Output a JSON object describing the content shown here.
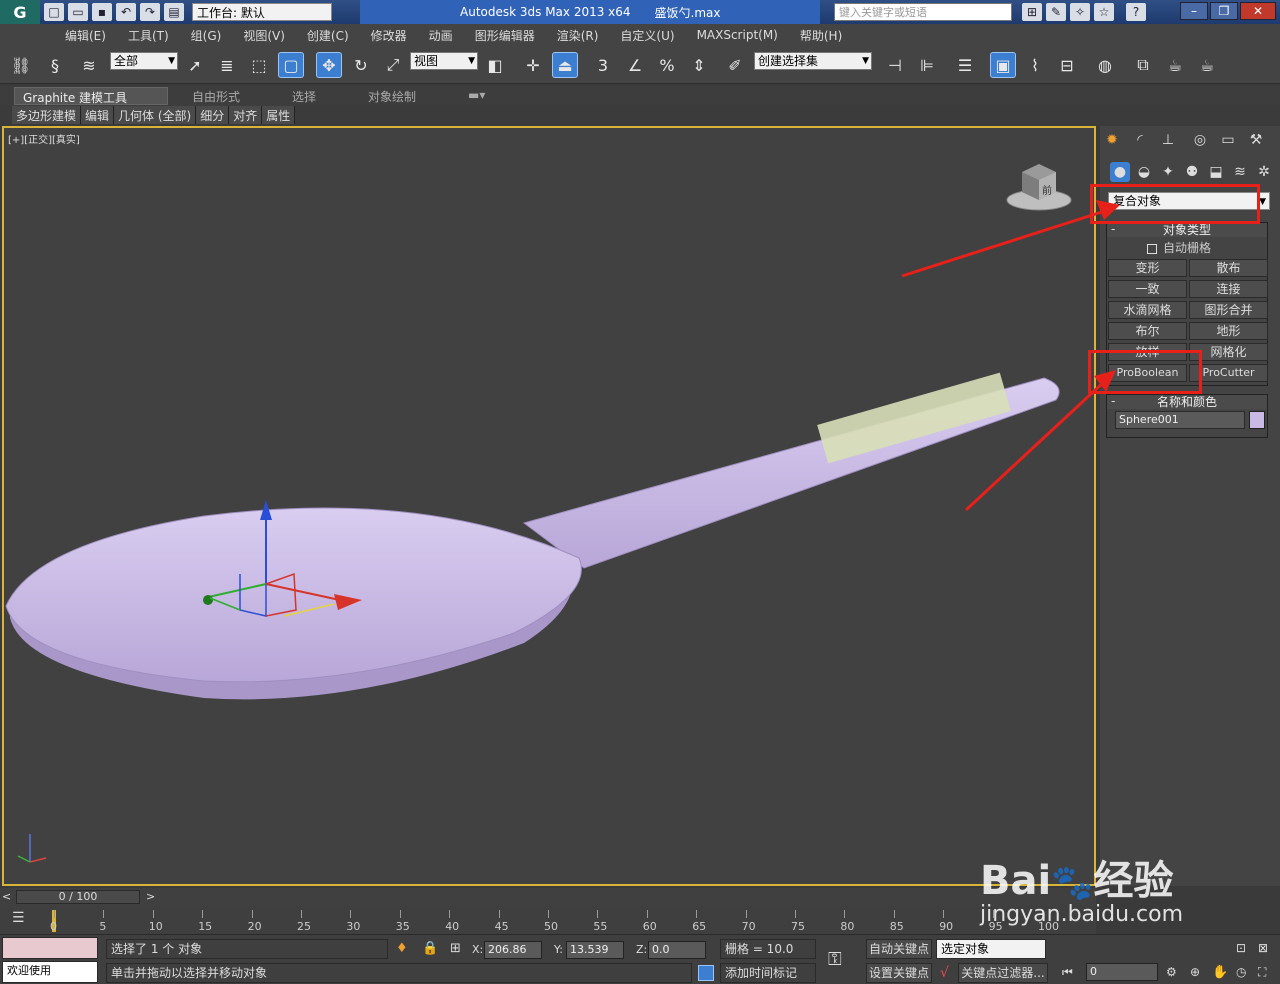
{
  "title_bar": {
    "workspace": "工作台: 默认",
    "app_name": "Autodesk 3ds Max  2013 x64",
    "file_name": "盛饭勺.max",
    "search_placeholder": "键入关键字或短语"
  },
  "menu": [
    "编辑(E)",
    "工具(T)",
    "组(G)",
    "视图(V)",
    "创建(C)",
    "修改器",
    "动画",
    "图形编辑器",
    "渲染(R)",
    "自定义(U)",
    "MAXScript(M)",
    "帮助(H)"
  ],
  "toolbar": {
    "filter": "全部",
    "ref_coord": "视图",
    "snap_3": "3",
    "named_selection": "创建选择集"
  },
  "ribbon": {
    "tabs": [
      "Graphite 建模工具",
      "自由形式",
      "选择",
      "对象绘制"
    ],
    "sub": [
      "多边形建模",
      "编辑",
      "几何体 (全部)",
      "细分",
      "对齐",
      "属性"
    ]
  },
  "viewport": {
    "label": "[+][正交][真实]",
    "cube_label": "前"
  },
  "command_panel": {
    "category": "复合对象",
    "object_type_title": "对象类型",
    "autogrid_label": "自动栅格",
    "buttons": [
      [
        "变形",
        "散布"
      ],
      [
        "一致",
        "连接"
      ],
      [
        "水滴网格",
        "图形合并"
      ],
      [
        "布尔",
        "地形"
      ],
      [
        "放样",
        "网格化"
      ],
      [
        "ProBoolean",
        "ProCutter"
      ]
    ],
    "name_color_title": "名称和颜色",
    "object_name": "Sphere001",
    "object_color": "#c9b9e6"
  },
  "timeline": {
    "frame_display": "0 / 100",
    "ticks": [
      "0",
      "5",
      "10",
      "15",
      "20",
      "25",
      "30",
      "35",
      "40",
      "45",
      "50",
      "55",
      "60",
      "65",
      "70",
      "75",
      "80",
      "85",
      "90",
      "95",
      "100"
    ]
  },
  "status": {
    "maxscript_label": "欢迎使用 MAXSci",
    "selection_info": "选择了 1 个 对象",
    "prompt": "单击并拖动以选择并移动对象",
    "x_value": "206.86",
    "y_value": "13.539",
    "z_value": "0.0",
    "grid": "栅格 = 10.0",
    "add_time_tag": "添加时间标记",
    "auto_key": "自动关键点",
    "set_key": "设置关键点",
    "selected_object": "选定对象",
    "key_filters": "关键点过滤器...",
    "frame_field": "0"
  },
  "watermark": {
    "brand": "Bai",
    "brand_suffix": "经验",
    "url": "jingyan.baidu.com"
  }
}
